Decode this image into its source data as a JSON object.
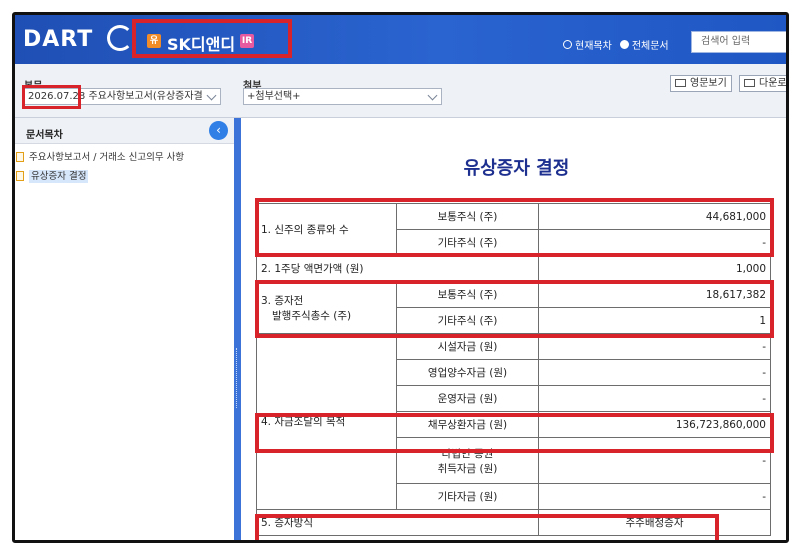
{
  "header": {
    "logo": "DART",
    "company_badge_left": "유",
    "company_name": "SK디앤디",
    "company_badge_right": "IR",
    "radio_current": "현재목차",
    "radio_all": "전체문서",
    "search_placeholder": "검색어 입력",
    "colors": {
      "brand": "#2a64d0",
      "highlight": "#d8232a"
    }
  },
  "toolbar": {
    "bonmun_label": "본문",
    "date": "2026.07.28",
    "report_name": "주요사항보고서(유상증자결",
    "attach_label": "첨부",
    "attach_select": "+첨부선택+",
    "btn_english": "영문보기",
    "btn_download": "다운로"
  },
  "sidebar": {
    "title": "문서목차",
    "items": [
      {
        "label": "주요사항보고서 / 거래소 신고의무 사항",
        "icon": "document-icon",
        "active": false
      },
      {
        "label": "유상증자 결정",
        "icon": "document-icon",
        "active": true
      }
    ]
  },
  "document": {
    "title": "유상증자 결정",
    "rows": {
      "r1_label": "1. 신주의 종류와 수",
      "r1a_sub": "보통주식 (주)",
      "r1a_val": "44,681,000",
      "r1b_sub": "기타주식 (주)",
      "r1b_val": "-",
      "r2_label": "2. 1주당 액면가액 (원)",
      "r2_val": "1,000",
      "r3_label_1": "3. 증자전",
      "r3_label_2": "발행주식총수 (주)",
      "r3a_sub": "보통주식 (주)",
      "r3a_val": "18,617,382",
      "r3b_sub": "기타주식 (주)",
      "r3b_val": "1",
      "r4_label": "4. 자금조달의 목적",
      "r4a_sub": "시설자금 (원)",
      "r4a_val": "-",
      "r4b_sub": "영업양수자금 (원)",
      "r4b_val": "-",
      "r4c_sub": "운영자금 (원)",
      "r4c_val": "-",
      "r4d_sub": "채무상환자금 (원)",
      "r4d_val": "136,723,860,000",
      "r4e_sub_1": "타법인 증권",
      "r4e_sub_2": "취득자금 (원)",
      "r4e_val": "-",
      "r4f_sub": "기타자금 (원)",
      "r4f_val": "-",
      "r5_label": "5. 증자방식",
      "r5_val": "주주배정증자"
    }
  }
}
